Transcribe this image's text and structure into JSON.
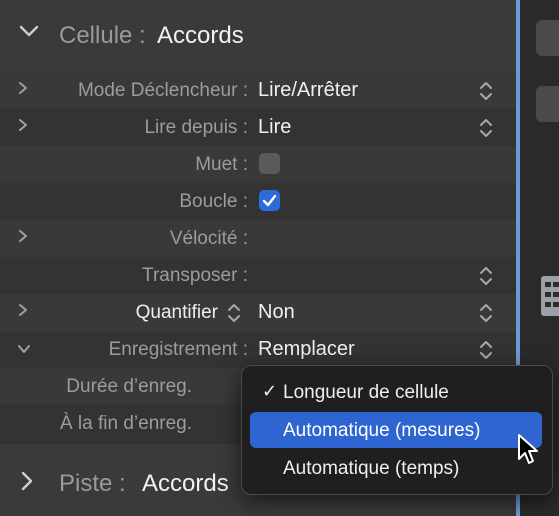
{
  "region": {
    "label": "Cellule :",
    "name": "Accords"
  },
  "rows": [
    {
      "label": "Mode Déclencheur :",
      "value": "Lire/Arrêter"
    },
    {
      "label": "Lire depuis :",
      "value": "Lire"
    },
    {
      "label": "Muet :",
      "checked": false
    },
    {
      "label": "Boucle :",
      "checked": true
    },
    {
      "label": "Vélocité :",
      "value": ""
    },
    {
      "label": "Transposer :",
      "value": ""
    },
    {
      "label": "Quantifier",
      "value": "Non"
    },
    {
      "label": "Enregistrement :",
      "value": "Remplacer"
    },
    {
      "label": "Durée d’enreg.",
      "value": ""
    },
    {
      "label": "À la fin d’enreg.",
      "value": ""
    }
  ],
  "track": {
    "label": "Piste :",
    "name": "Accords"
  },
  "popup": {
    "items": [
      {
        "label": "Longueur de cellule",
        "checked": true,
        "highlighted": false
      },
      {
        "label": "Automatique (mesures)",
        "checked": false,
        "highlighted": true
      },
      {
        "label": "Automatique (temps)",
        "checked": false,
        "highlighted": false
      }
    ],
    "checkmark": "✓"
  },
  "icons": {
    "chevron_down": "chevron-down-icon",
    "chevron_right": "chevron-right-icon",
    "stepper": "up-down-stepper-icon",
    "cursor": "pointer-cursor-icon"
  },
  "colors": {
    "accent": "#2e65d1",
    "checkbox_on": "#2d6bd8"
  }
}
